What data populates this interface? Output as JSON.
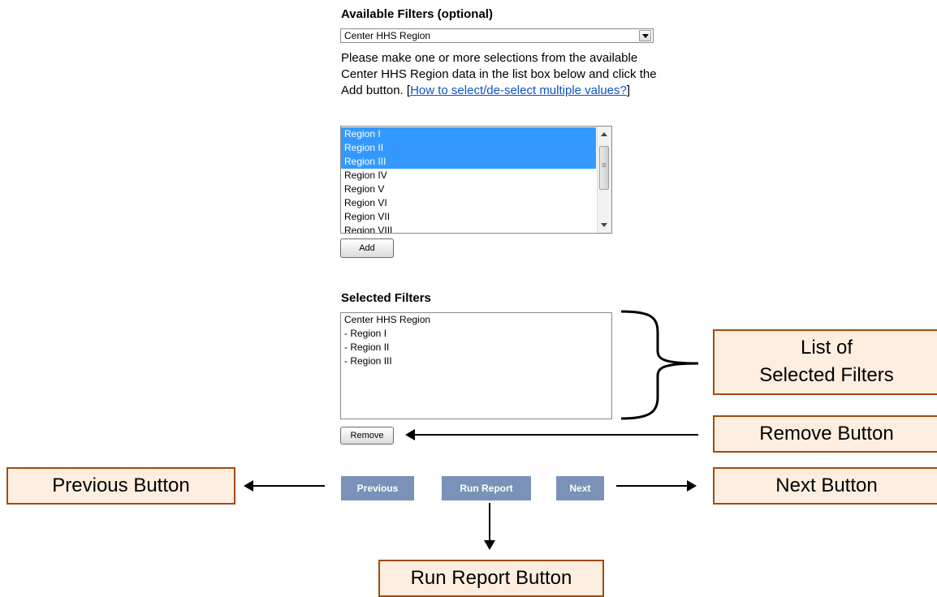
{
  "available": {
    "heading": "Available Filters (optional)",
    "dropdown_value": "Center HHS Region",
    "instructions": "Please make one or more selections from the available Center HHS Region data in the list box below and click the Add button. [",
    "help_link": "How to select/de-select multiple values?",
    "instructions_end": "]",
    "options": [
      {
        "label": "Region I",
        "selected": true
      },
      {
        "label": "Region II",
        "selected": true
      },
      {
        "label": "Region III",
        "selected": true
      },
      {
        "label": "Region IV",
        "selected": false
      },
      {
        "label": "Region V",
        "selected": false
      },
      {
        "label": "Region VI",
        "selected": false
      },
      {
        "label": "Region VII",
        "selected": false
      },
      {
        "label": "Region VIII",
        "selected": false
      }
    ],
    "add_label": "Add"
  },
  "selected": {
    "heading": "Selected Filters",
    "lines": [
      "Center HHS Region",
      "- Region I",
      "- Region II",
      "- Region III"
    ],
    "remove_label": "Remove"
  },
  "nav": {
    "previous": "Previous",
    "run_report": "Run Report",
    "next": "Next"
  },
  "callouts": {
    "list_line1": "List of",
    "list_line2": "Selected Filters",
    "remove": "Remove Button",
    "previous": "Previous Button",
    "next": "Next Button",
    "run_report": "Run Report Button"
  },
  "colors": {
    "selection": "#3399ff",
    "nav_button": "#7a92b8",
    "callout_fill": "#fdeee0",
    "callout_border": "#a24a12",
    "link": "#0b53c8"
  }
}
